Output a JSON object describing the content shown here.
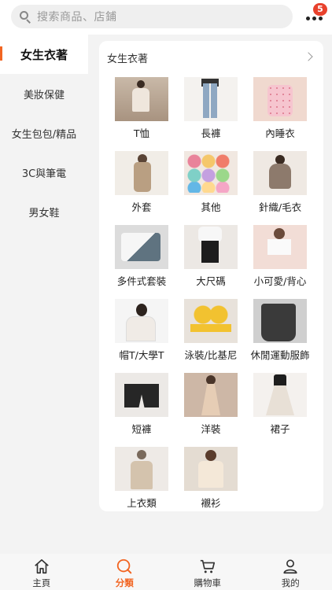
{
  "search": {
    "placeholder": "搜索商品、店鋪"
  },
  "header": {
    "notification_count": "5"
  },
  "sidebar": {
    "items": [
      {
        "label": "女生衣著",
        "active": true
      },
      {
        "label": "美妝保健",
        "active": false
      },
      {
        "label": "女生包包/精品",
        "active": false
      },
      {
        "label": "3C與筆電",
        "active": false
      },
      {
        "label": "男女鞋",
        "active": false
      }
    ]
  },
  "panel": {
    "title": "女生衣著",
    "categories": [
      {
        "label": "T恤",
        "icon": "tshirt-photo"
      },
      {
        "label": "長褲",
        "icon": "jeans-photo"
      },
      {
        "label": "內睡衣",
        "icon": "pajama-photo"
      },
      {
        "label": "外套",
        "icon": "jacket-photo"
      },
      {
        "label": "其他",
        "icon": "yarn-photo"
      },
      {
        "label": "針織/毛衣",
        "icon": "knit-photo"
      },
      {
        "label": "多件式套裝",
        "icon": "set-photo"
      },
      {
        "label": "大尺碼",
        "icon": "plus-size-photo"
      },
      {
        "label": "小可愛/背心",
        "icon": "cami-photo"
      },
      {
        "label": "帽T/大學T",
        "icon": "hoodie-photo"
      },
      {
        "label": "泳裝/比基尼",
        "icon": "swimwear-photo"
      },
      {
        "label": "休閒運動服飾",
        "icon": "sportswear-photo"
      },
      {
        "label": "短褲",
        "icon": "shorts-photo"
      },
      {
        "label": "洋裝",
        "icon": "dress-photo"
      },
      {
        "label": "裙子",
        "icon": "skirt-photo"
      },
      {
        "label": "上衣類",
        "icon": "tops-photo"
      },
      {
        "label": "襯衫",
        "icon": "shirt-photo"
      }
    ]
  },
  "tabbar": {
    "items": [
      {
        "label": "主頁",
        "icon": "home-icon",
        "active": false
      },
      {
        "label": "分類",
        "icon": "category-search-icon",
        "active": true
      },
      {
        "label": "購物車",
        "icon": "cart-icon",
        "active": false
      },
      {
        "label": "我的",
        "icon": "profile-icon",
        "active": false
      }
    ]
  },
  "colors": {
    "accent": "#f26522",
    "badge": "#e8412c"
  }
}
